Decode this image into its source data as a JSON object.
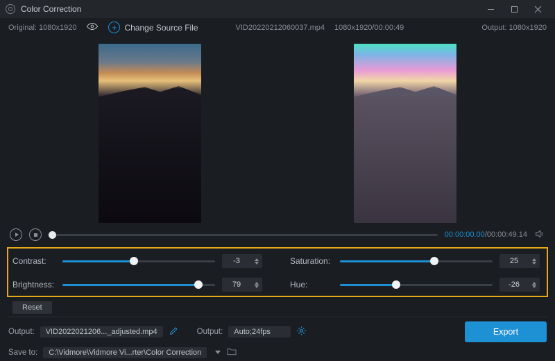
{
  "titlebar": {
    "title": "Color Correction"
  },
  "header": {
    "original_label": "Original: 1080x1920",
    "change_source_label": "Change Source File",
    "filename": "VID20220212060037.mp4",
    "fileinfo": "1080x1920/00:00:49",
    "output_label": "Output: 1080x1920"
  },
  "playback": {
    "current_time": "00:00:00.00",
    "duration": "00:00:49.14"
  },
  "controls": {
    "contrast": {
      "label": "Contrast:",
      "value": "-3",
      "fill_pct": 47,
      "knob_pct": 47
    },
    "brightness": {
      "label": "Brightness:",
      "value": "79",
      "fill_pct": 89,
      "knob_pct": 89
    },
    "saturation": {
      "label": "Saturation:",
      "value": "25",
      "fill_pct": 62,
      "knob_pct": 62
    },
    "hue": {
      "label": "Hue:",
      "value": "-26",
      "fill_pct": 37,
      "knob_pct": 37
    },
    "reset_label": "Reset"
  },
  "bottom": {
    "output_label": "Output:",
    "output_file": "VID2022021206..._adjusted.mp4",
    "output2_label": "Output:",
    "output2_value": "Auto;24fps",
    "saveto_label": "Save to:",
    "saveto_path": "C:\\Vidmore\\Vidmore Vi...rter\\Color Correction",
    "export_label": "Export"
  }
}
